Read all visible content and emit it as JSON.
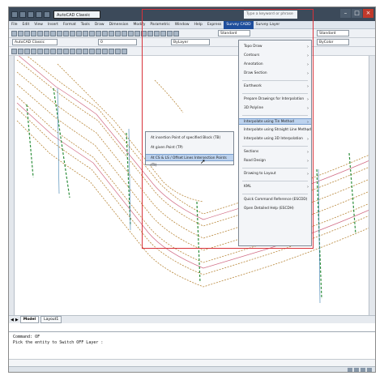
{
  "titlebar": {
    "workspace": "AutoCAD Classic",
    "title": "",
    "search_placeholder": "Type a keyword or phrase",
    "minimize": "–",
    "maximize": "□",
    "close": "×"
  },
  "menubar": {
    "items": [
      "File",
      "Edit",
      "View",
      "Insert",
      "Format",
      "Tools",
      "Draw",
      "Dimension",
      "Modify",
      "Parametric",
      "Window",
      "Help",
      "Express",
      "Survey CADD",
      "Survey Layer"
    ],
    "active_index": 13
  },
  "toolbars": {
    "dimstyle_combo": "Standard",
    "tablestyle_combo": "Standard",
    "workspace_combo": "AutoCAD Classic",
    "layer_combo": "0",
    "color_combo": "ByLayer",
    "linetype_combo": "ByColor"
  },
  "survey_menu": {
    "items": [
      {
        "label": "Topo Draw",
        "submenu": true
      },
      {
        "label": "Contours",
        "submenu": true
      },
      {
        "label": "Annotation",
        "submenu": true
      },
      {
        "label": "Draw Section",
        "submenu": true
      },
      {
        "label": "Earthwork",
        "submenu": true
      },
      {
        "label": "Prepare Drawings for Interpolation",
        "submenu": true
      },
      {
        "label": "3D Polyline",
        "submenu": true
      },
      {
        "label": "Interpolate using Tin Method",
        "submenu": true,
        "highlighted": true
      },
      {
        "label": "Interpolate using Straight Line Method",
        "submenu": true
      },
      {
        "label": "Interpolate using 3D Interpolation",
        "submenu": true
      },
      {
        "label": "Sections",
        "submenu": true
      },
      {
        "label": "Road Design",
        "submenu": true
      },
      {
        "label": "Drawing to Layout",
        "submenu": true
      },
      {
        "label": "KML",
        "submenu": true
      },
      {
        "label": "Quick Command Reference (ESCDD)",
        "submenu": false
      },
      {
        "label": "Open Detailed Help (ESCDH)",
        "submenu": false
      }
    ]
  },
  "submenu": {
    "items": [
      {
        "label": "At insertion Point of specified Block (TB)"
      },
      {
        "label": "At given Point (TP)"
      },
      {
        "label": "At CS & LS / Offset Lines Intersection Points (TI)",
        "highlighted": true
      }
    ]
  },
  "layout_tabs": [
    "Model",
    "Layout1"
  ],
  "command_window": {
    "line1": "Command: OF",
    "line2": "Pick the entity to Switch OFF Layer :"
  },
  "colors": {
    "frame": "#d8323a",
    "highlight": "#bcd2ee",
    "contour": "#b8873a",
    "section_line": "#2e8f3c"
  }
}
